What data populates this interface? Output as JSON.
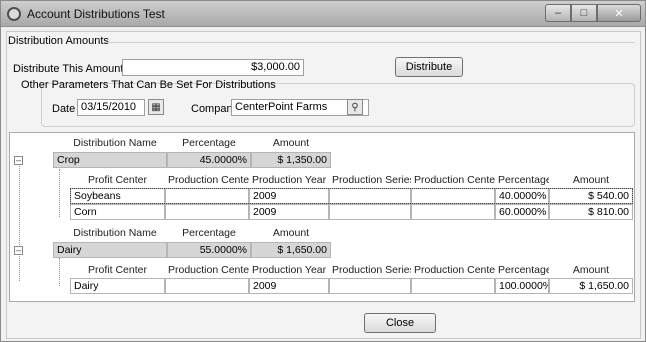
{
  "window": {
    "title": "Account Distributions Test"
  },
  "distribution_amounts": {
    "legend": "Distribution Amounts",
    "distribute_label": "Distribute This Amount",
    "distribute_value": "$3,000.00",
    "distribute_button": "Distribute",
    "other_params_legend": "Other Parameters That Can Be Set For Distributions",
    "date_label": "Date",
    "date_value": "03/15/2010",
    "company_label": "Company",
    "company_value": "CenterPoint Farms"
  },
  "grid": {
    "group_headers": [
      "Distribution Name",
      "Percentage",
      "Amount"
    ],
    "detail_headers": [
      "Profit Center",
      "Production Center",
      "Production Year",
      "Production Series",
      "Production Center",
      "Percentage",
      "Amount"
    ],
    "groups": [
      {
        "name": "Crop",
        "percentage": "45.0000%",
        "amount": "$ 1,350.00",
        "rows": [
          {
            "profit_center": "Soybeans",
            "production_center": "",
            "production_year": "2009",
            "production_series": "",
            "production_center2": "",
            "percentage": "40.0000%",
            "amount": "$ 540.00"
          },
          {
            "profit_center": "Corn",
            "production_center": "",
            "production_year": "2009",
            "production_series": "",
            "production_center2": "",
            "percentage": "60.0000%",
            "amount": "$ 810.00"
          }
        ]
      },
      {
        "name": "Dairy",
        "percentage": "55.0000%",
        "amount": "$ 1,650.00",
        "rows": [
          {
            "profit_center": "Dairy",
            "production_center": "",
            "production_year": "2009",
            "production_series": "",
            "production_center2": "",
            "percentage": "100.0000%",
            "amount": "$ 1,650.00"
          }
        ]
      }
    ]
  },
  "footer": {
    "close_button": "Close"
  }
}
